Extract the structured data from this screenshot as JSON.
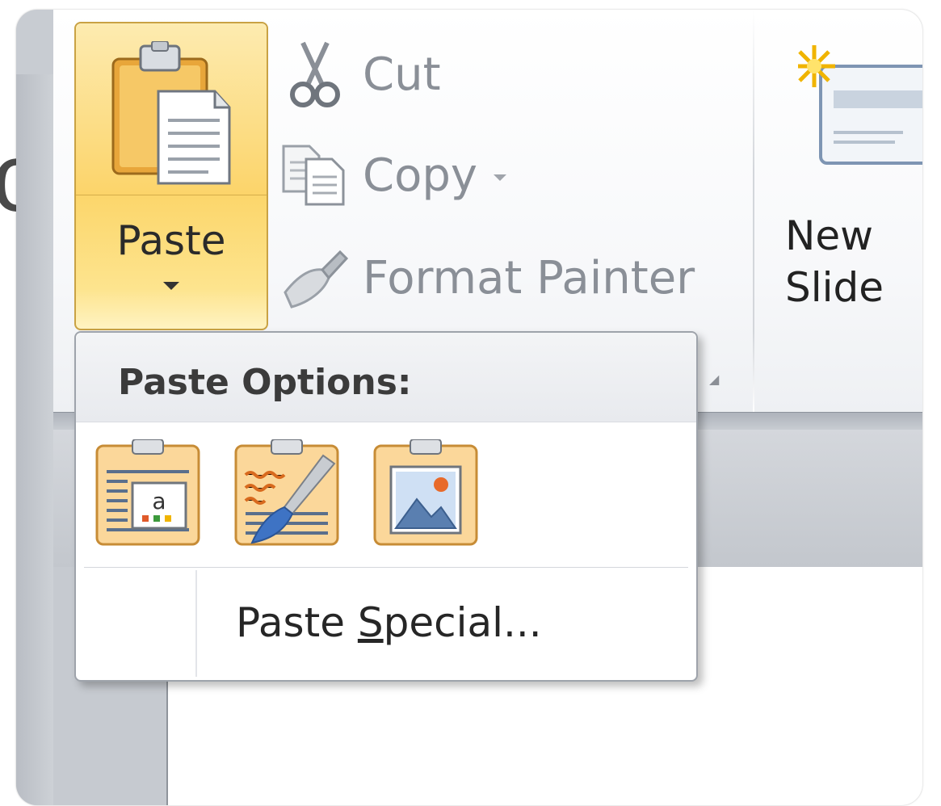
{
  "background": {
    "partial_letter": "c"
  },
  "ribbon": {
    "clipboard": {
      "paste_label": "Paste",
      "cut_label": "Cut",
      "copy_label": "Copy",
      "format_painter_label": "Format Painter"
    },
    "slides": {
      "new_slide_label": "New\nSlide"
    }
  },
  "paste_menu": {
    "header": "Paste Options:",
    "options": [
      {
        "icon": "paste-keep-text-icon"
      },
      {
        "icon": "paste-use-destination-theme-icon"
      },
      {
        "icon": "paste-as-picture-icon"
      }
    ],
    "paste_special_prefix": "Paste ",
    "paste_special_mnemonic": "S",
    "paste_special_rest": "pecial..."
  },
  "colors": {
    "paste_highlight": "#fcd363",
    "paste_border": "#c9a244",
    "disabled_text": "#8a8f97",
    "menu_border": "#9ea3ab"
  }
}
